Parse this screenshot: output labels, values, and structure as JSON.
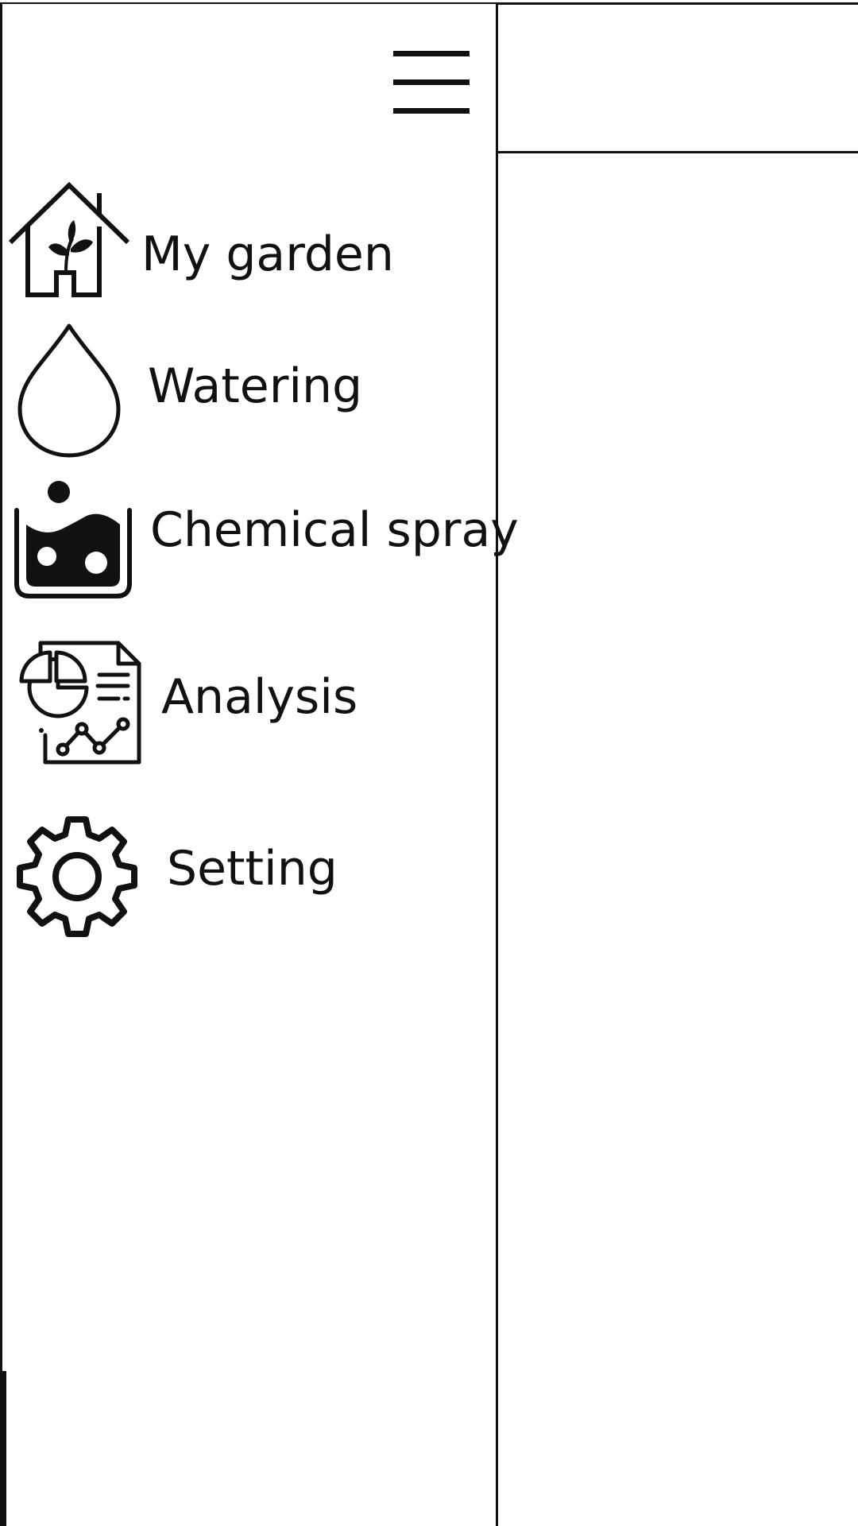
{
  "drawer": {
    "menu_icon": "hamburger-menu-icon",
    "items": [
      {
        "label": "My garden",
        "icon": "garden-house-icon"
      },
      {
        "label": "Watering",
        "icon": "water-drop-icon"
      },
      {
        "label": "Chemical spray",
        "icon": "chemical-beaker-icon"
      },
      {
        "label": "Analysis",
        "icon": "analysis-report-icon"
      },
      {
        "label": "Setting",
        "icon": "gear-icon"
      }
    ]
  },
  "colors": {
    "line": "#111111",
    "background": "#ffffff"
  }
}
